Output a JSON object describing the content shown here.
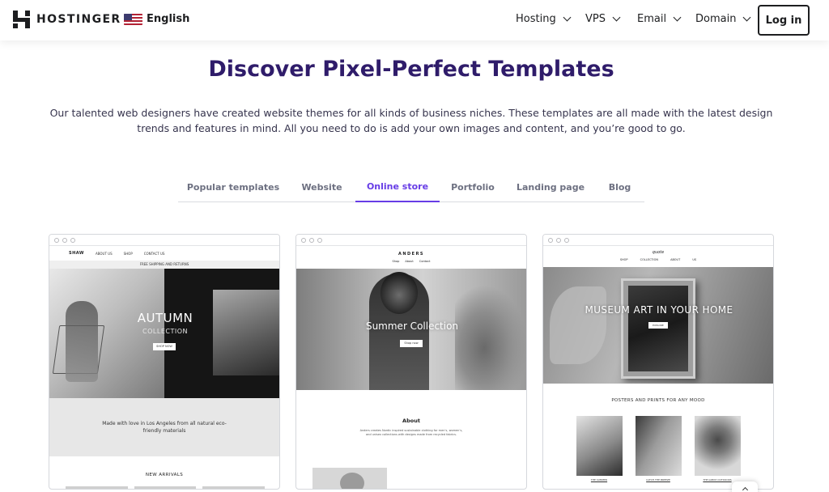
{
  "header": {
    "logo_text": "HOSTINGER",
    "language": "English",
    "nav": [
      {
        "label": "Hosting"
      },
      {
        "label": "VPS"
      },
      {
        "label": "Email"
      },
      {
        "label": "Domain"
      }
    ],
    "login_label": "Log in"
  },
  "hero": {
    "title": "Discover Pixel-Perfect Templates",
    "description": "Our talented web designers have created website themes for all kinds of business niches. These templates are all made with the latest design trends and features in mind. All you need to do is add your own images and content, and you’re good to go."
  },
  "tabs": [
    {
      "label": "Popular templates",
      "active": false
    },
    {
      "label": "Website",
      "active": false
    },
    {
      "label": "Online store",
      "active": true
    },
    {
      "label": "Portfolio",
      "active": false
    },
    {
      "label": "Landing page",
      "active": false
    },
    {
      "label": "Blog",
      "active": false
    }
  ],
  "templates": [
    {
      "brand": "SHAW",
      "nav_links": [
        "ABOUT US",
        "SHOP",
        "CONTACT US"
      ],
      "banner": "FREE SHIPPING AND RETURNS",
      "headline": "AUTUMN",
      "subheadline": "COLLECTION",
      "button": "SHOP NOW",
      "tagline": "Made with love in Los Angeles from all natural eco-friendly materials",
      "section": "NEW ARRIVALS"
    },
    {
      "brand": "ANDERS",
      "nav_links": "Shop   About   Contact",
      "headline": "Summer Collection",
      "button": "Shop now",
      "section": "About",
      "about_text": "Anders creates Nordic inspired sustainable clothing for men’s, women’s, and unisex collections with designs made from recycled fabrics."
    },
    {
      "brand": "quote",
      "nav_links": "SHOP   COLLECTION   ABOUT US",
      "headline": "MUSEUM ART IN YOUR HOME",
      "button": "EXPLORE",
      "section": "POSTERS AND PRINTS FOR ANY MOOD",
      "prints": [
        "THE SUMMER",
        "CATCH THE BREEZE",
        "THE GREAT OUTDOORS"
      ]
    }
  ]
}
